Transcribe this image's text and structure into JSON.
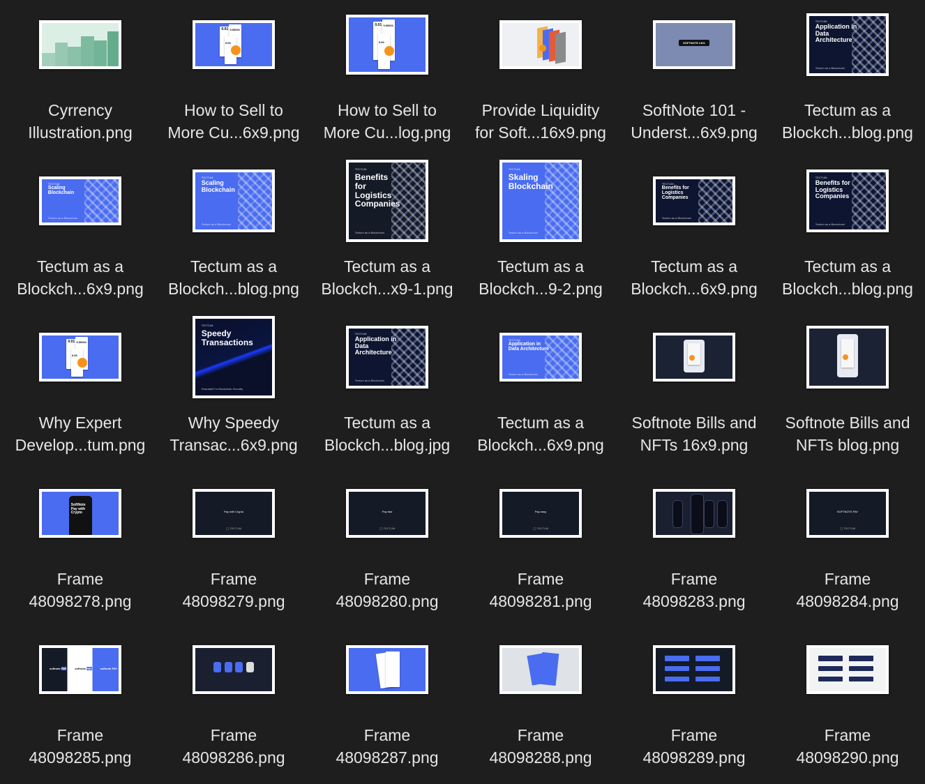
{
  "files": [
    {
      "line1": "Cyrrency",
      "line2": "Illustration.png",
      "thumb": "green-bars",
      "w": 118,
      "h": 70
    },
    {
      "line1": "How to Sell to",
      "line2": "More Cu...6x9.png",
      "thumb": "blue-tickets-wide",
      "w": 118,
      "h": 70,
      "texts": [
        "0.01",
        "0.00001",
        "0.00"
      ]
    },
    {
      "line1": "How to Sell to",
      "line2": "More Cu...log.png",
      "thumb": "blue-tickets",
      "w": 118,
      "h": 86,
      "texts": [
        "0.01",
        "0.00001",
        "0.00"
      ]
    },
    {
      "line1": "Provide Liquidity",
      "line2": "for Soft...16x9.png",
      "thumb": "light-tickets",
      "w": 118,
      "h": 70
    },
    {
      "line1": "SoftNote 101 -",
      "line2": "Underst...6x9.png",
      "thumb": "softnote-101",
      "w": 118,
      "h": 70,
      "texts": [
        "SOFTNOTE #101"
      ]
    },
    {
      "line1": "Tectum as a",
      "line2": "Blockch...blog.png",
      "thumb": "navy-cubes",
      "w": 118,
      "h": 90,
      "texts": [
        "Application in Data Architecture"
      ]
    },
    {
      "line1": "Tectum as a",
      "line2": "Blockch...6x9.png",
      "thumb": "blue-cubes",
      "w": 118,
      "h": 70,
      "texts": [
        "Scaling Blockchain"
      ]
    },
    {
      "line1": "Tectum as a",
      "line2": "Blockch...blog.png",
      "thumb": "blue-cubes",
      "w": 118,
      "h": 90,
      "texts": [
        "Scaling Blockchain"
      ]
    },
    {
      "line1": "Tectum as a",
      "line2": "Blockch...x9-1.png",
      "thumb": "dark-cubes",
      "w": 118,
      "h": 118,
      "texts": [
        "Benefits for Logistics Companies"
      ]
    },
    {
      "line1": "Tectum as a",
      "line2": "Blockch...9-2.png",
      "thumb": "blue-cubes",
      "w": 118,
      "h": 118,
      "texts": [
        "Skaling Blockchain"
      ]
    },
    {
      "line1": "Tectum as a",
      "line2": "Blockch...6x9.png",
      "thumb": "navy-cubes",
      "w": 118,
      "h": 70,
      "texts": [
        "Benefits for Logistics Companies"
      ]
    },
    {
      "line1": "Tectum as a",
      "line2": "Blockch...blog.png",
      "thumb": "navy-cubes",
      "w": 118,
      "h": 90,
      "texts": [
        "Benefits for Logistics Companies"
      ]
    },
    {
      "line1": "Why Expert",
      "line2": "Develop...tum.png",
      "thumb": "blue-tickets-wide",
      "w": 118,
      "h": 70,
      "texts": [
        "0.01",
        "0.00001",
        "0.00"
      ]
    },
    {
      "line1": "Why Speedy",
      "line2": "Transac...6x9.png",
      "thumb": "speedy",
      "w": 118,
      "h": 118,
      "texts": [
        "Speedy Transactions",
        "Essential For Blockchain Security"
      ]
    },
    {
      "line1": "Tectum as a",
      "line2": "Blockch...blog.jpg",
      "thumb": "navy-cubes",
      "w": 118,
      "h": 90,
      "texts": [
        "Application in Data Architecture"
      ]
    },
    {
      "line1": "Tectum as a",
      "line2": "Blockch...6x9.png",
      "thumb": "blue-cubes",
      "w": 118,
      "h": 70,
      "texts": [
        "Application in Data Architecture"
      ]
    },
    {
      "line1": "Softnote Bills and",
      "line2": "NFTs 16x9.png",
      "thumb": "softnote-card",
      "w": 118,
      "h": 70
    },
    {
      "line1": "Softnote Bills and",
      "line2": "NFTs blog.png",
      "thumb": "softnote-card",
      "w": 118,
      "h": 90
    },
    {
      "line1": "Frame",
      "line2": "48098278.png",
      "thumb": "blue-phone",
      "w": 118,
      "h": 70,
      "texts": [
        "SoftNote Pay with Crypto"
      ]
    },
    {
      "line1": "Frame",
      "line2": "48098279.png",
      "thumb": "dark-pay",
      "w": 118,
      "h": 70,
      "texts": [
        "Pay with Crypto"
      ]
    },
    {
      "line1": "Frame",
      "line2": "48098280.png",
      "thumb": "dark-pay",
      "w": 118,
      "h": 70,
      "texts": [
        "Pay fast"
      ]
    },
    {
      "line1": "Frame",
      "line2": "48098281.png",
      "thumb": "dark-pay",
      "w": 118,
      "h": 70,
      "texts": [
        "Pay easy"
      ]
    },
    {
      "line1": "Frame",
      "line2": "48098283.png",
      "thumb": "dark-phones",
      "w": 118,
      "h": 70
    },
    {
      "line1": "Frame",
      "line2": "48098284.png",
      "thumb": "dark-pay",
      "w": 118,
      "h": 70,
      "texts": [
        "SOFTNOTE PAY"
      ]
    },
    {
      "line1": "Frame",
      "line2": "48098285.png",
      "thumb": "tri-panel",
      "w": 118,
      "h": 70
    },
    {
      "line1": "Frame",
      "line2": "48098286.png",
      "thumb": "dark-apps",
      "w": 118,
      "h": 70
    },
    {
      "line1": "Frame",
      "line2": "48098287.png",
      "thumb": "blue-flyers",
      "w": 118,
      "h": 70
    },
    {
      "line1": "Frame",
      "line2": "48098288.png",
      "thumb": "light-flyers",
      "w": 118,
      "h": 70
    },
    {
      "line1": "Frame",
      "line2": "48098289.png",
      "thumb": "dark-badges",
      "w": 118,
      "h": 70
    },
    {
      "line1": "Frame",
      "line2": "48098290.png",
      "thumb": "light-badges",
      "w": 118,
      "h": 70
    }
  ]
}
